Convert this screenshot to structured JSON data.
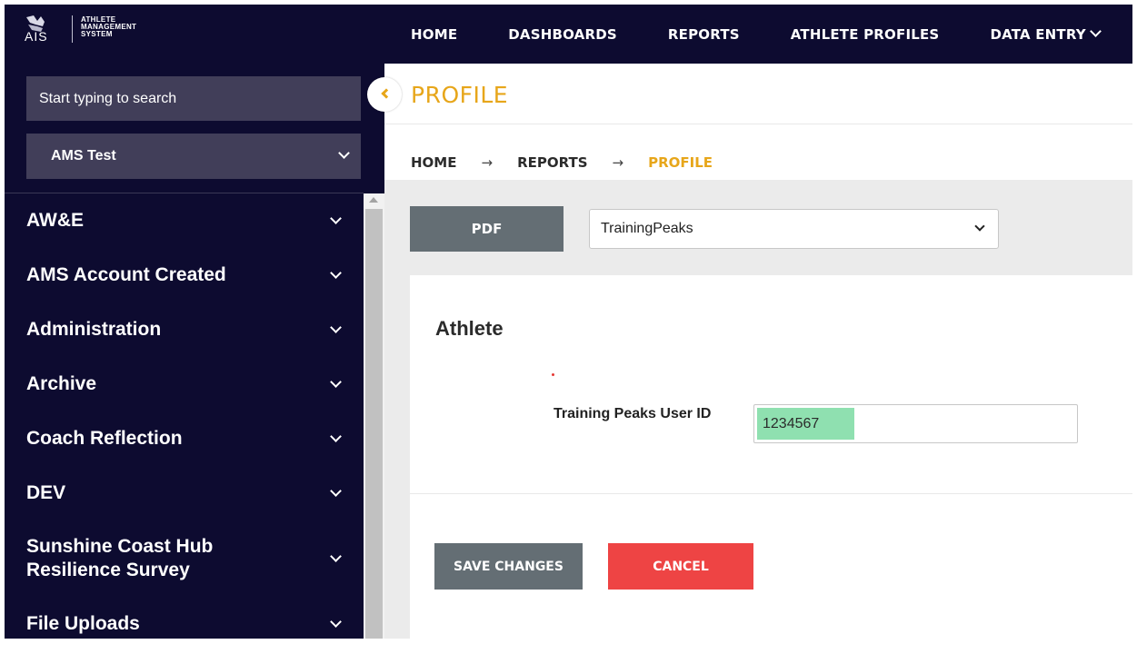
{
  "logo": {
    "acronym": "AIS",
    "line1": "ATHLETE",
    "line2": "MANAGEMENT",
    "line3": "SYSTEM"
  },
  "nav": {
    "items": [
      "HOME",
      "DASHBOARDS",
      "REPORTS",
      "ATHLETE PROFILES",
      "DATA ENTRY"
    ]
  },
  "sidebar": {
    "search_placeholder": "Start typing to search",
    "selected_group": "AMS Test",
    "menu": [
      "AW&E",
      "AMS Account Created",
      "Administration",
      "Archive",
      "Coach Reflection",
      "DEV",
      "Sunshine Coast Hub Resilience Survey",
      "File Uploads"
    ]
  },
  "page": {
    "title": "PROFILE",
    "breadcrumb": [
      "HOME",
      "REPORTS",
      "PROFILE"
    ],
    "breadcrumb_separator": "→"
  },
  "toolbar": {
    "pdf_label": "PDF",
    "report_selected": "TrainingPeaks"
  },
  "form": {
    "section_title": "Athlete",
    "field_label": "Training Peaks User ID",
    "field_value": "1234567",
    "save_label": "SAVE CHANGES",
    "cancel_label": "CANCEL"
  },
  "colors": {
    "navy": "#0d0b30",
    "accent": "#e7a61a",
    "button_grey": "#646e74",
    "danger": "#ee4444",
    "highlight": "#8fe0b0"
  }
}
